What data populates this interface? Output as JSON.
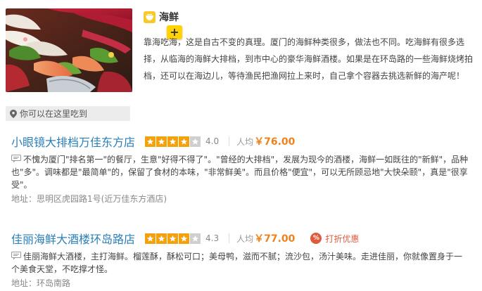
{
  "food": {
    "title": "海鲜",
    "plus_label": "+",
    "description": "靠海吃海，这是自古不变的真理。厦门的海鲜种类很多，做法也不同。吃海鲜有很多选择，从临海的海鲜大排档，到市中心的豪华海鲜酒楼。如果是在环岛路的一些海鲜烧烤拍档，还可以在海边儿，等待渔民把渔网拉上来时，自己拿个容器去挑选新鲜的海产呢！"
  },
  "where": {
    "label": "你可以在这里吃到"
  },
  "restaurants": [
    {
      "name": "小眼镜大排档万佳东方店",
      "stars": 4,
      "score": "4.0",
      "avg_label": "人均",
      "avg_price": "￥76.00",
      "promo": "",
      "description": "不愧为厦门\"排名第一\"的餐厅，生意\"好得不得了\"。\"曾经的大排档\"，发展为现今的酒楼，海鲜一如既往的\"新鲜\"，品种也\"多\"。调味都是\"最简单\"的，保留了食材的本味，\"非常鲜美\"。而且价格\"便宜\"，可以无所顾忌地\"大快朵颐\"，真是\"很享受\"。",
      "address": "地址：思明区虎园路1号(近万佳东方酒店)"
    },
    {
      "name": "佳丽海鲜大酒楼环岛路店",
      "stars": 4,
      "score": "4.3",
      "avg_label": "人均",
      "avg_price": "￥77.00",
      "promo": "打折优惠",
      "promo_icon": "%",
      "description": "佳丽海鲜大酒楼，主打海鲜。榴莲酥，酥松可口；美母鸭，滋而不腻；流沙包，汤汁美味。走进佳丽，你就像置身于一个美食天堂，不吃撑才怪。",
      "address": "地址：环岛南路"
    }
  ],
  "colors": {
    "link": "#2a7fb8",
    "price": "#f0821e",
    "star_on": "#f3a20d",
    "star_off": "#cfcfcf",
    "promo": "#e05a3c",
    "accent_yellow": "#ffd200"
  },
  "icons": {
    "category": "bowl-icon",
    "location": "map-pin-icon",
    "quote": "comment-icon",
    "star": "star-icon"
  }
}
